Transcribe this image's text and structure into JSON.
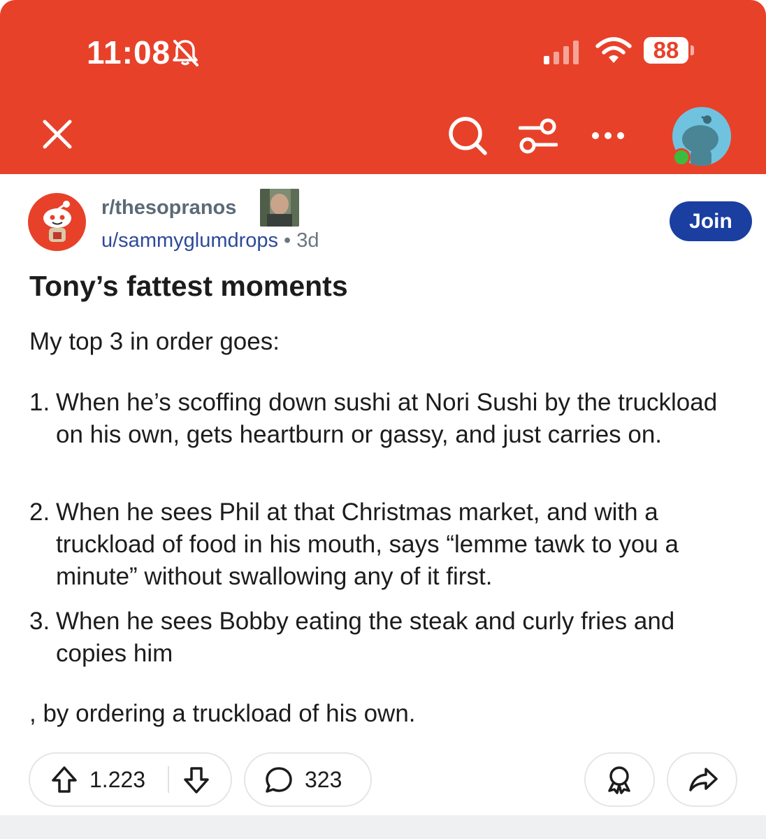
{
  "status_bar": {
    "time": "11:08",
    "battery": "88"
  },
  "toolbar": {
    "close_icon": "close-icon",
    "search_icon": "search-icon",
    "filter_icon": "sliders-icon",
    "more_icon": "more-icon",
    "avatar_icon": "snoo-avatar"
  },
  "post": {
    "subreddit": "r/thesopranos",
    "author": "u/sammyglumdrops",
    "separator": "•",
    "age": "3d",
    "join_label": "Join",
    "title": "Tony’s fattest moments",
    "intro": "My top 3 in order goes:",
    "list": [
      {
        "num": "1.",
        "text": "When he’s scoffing down sushi at Nori Sushi by the truckload on his own, gets heartburn or gassy, and just carries on."
      },
      {
        "num": "2.",
        "text": "When he sees Phil at that Christmas market, and with a truckload of food in his mouth, says “lemme tawk to you a minute” without swallowing any of it first."
      },
      {
        "num": "3.",
        "text": "When he sees Bobby eating the steak and curly fries and copies him"
      }
    ],
    "trailing": ", by ordering a truckload of his own."
  },
  "actions": {
    "upvotes": "1.223",
    "comments": "323"
  },
  "colors": {
    "header": "#e8412a",
    "join_button": "#1a3fa0",
    "username": "#2d4a9a"
  }
}
